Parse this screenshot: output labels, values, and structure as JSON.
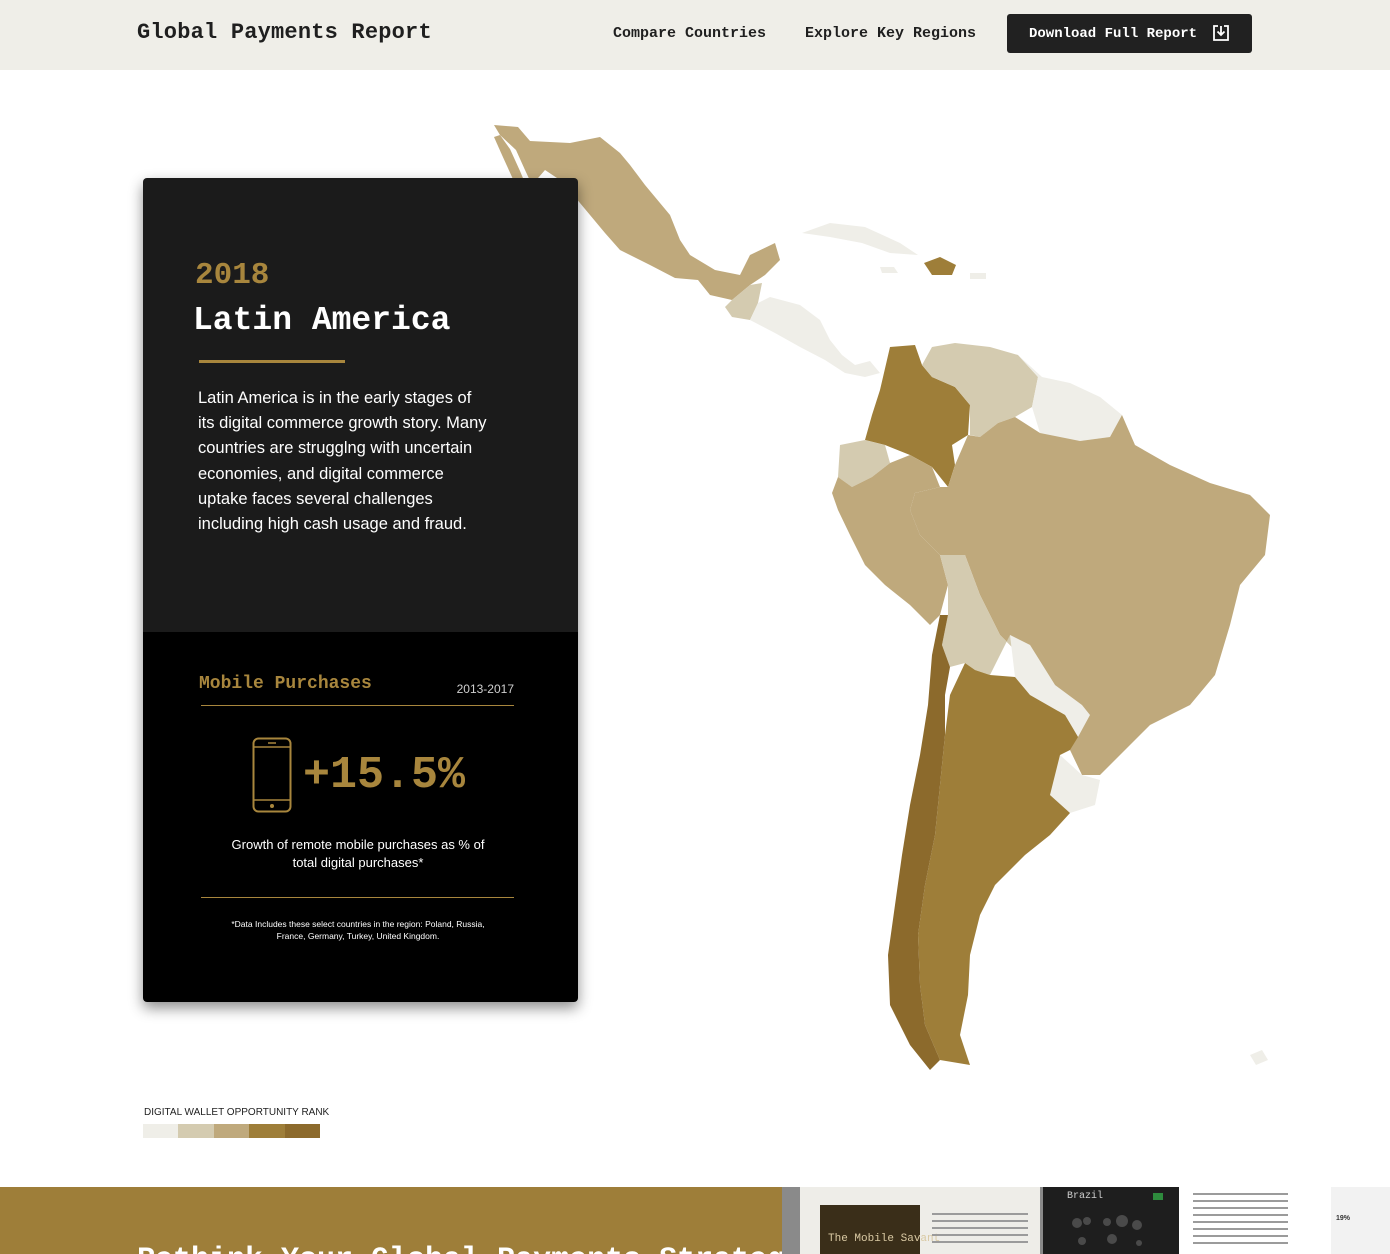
{
  "header": {
    "brand": "Global Payments Report",
    "nav": [
      "Compare Countries",
      "Explore Key Regions"
    ],
    "download_label": "Download Full Report"
  },
  "card": {
    "year": "2018",
    "region": "Latin America",
    "description": "Latin America is in the early stages of its digital commerce growth story. Many countries are strugglng with uncertain economies, and digital commerce uptake faces several challenges including high cash usage and fraud.",
    "metric_title": "Mobile Purchases",
    "metric_years": "2013-2017",
    "metric_value": "+15.5%",
    "metric_caption": "Growth of remote mobile purchases as % of total digital purchases*",
    "footnote": "*Data Includes these select countries in the region: Poland, Russia, France, Germany, Turkey, United Kingdom.",
    "icon": "smartphone-icon"
  },
  "legend": {
    "title": "DIGITAL WALLET OPPORTUNITY RANK",
    "swatches": [
      "#efeee8",
      "#d4cbb0",
      "#bfa97c",
      "#9e7e39",
      "#8c6a2c"
    ]
  },
  "teaser": {
    "heading": "Rethink Your Global Payments Strategy",
    "panel_title": "The Mobile Savant",
    "panel_country": "Brazil",
    "panel_percent": "19%"
  },
  "colors": {
    "accent_gold": "#a8863d",
    "header_bg": "#efeee8",
    "card_dark": "#1b1b1b",
    "rank_1": "#efeee8",
    "rank_2": "#d4cbb0",
    "rank_3": "#bfa97c",
    "rank_4": "#9e7e39",
    "rank_5": "#8c6a2c"
  }
}
